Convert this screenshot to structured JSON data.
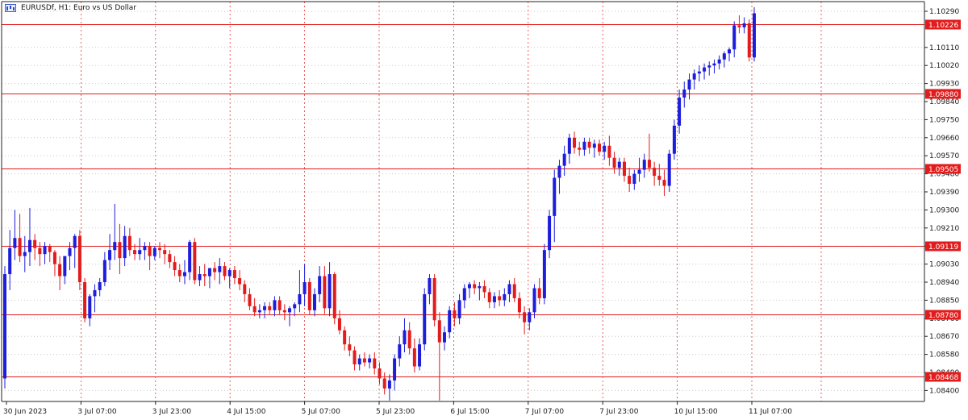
{
  "window": {
    "title": "EURUSDf, H1:  Euro vs US Dollar",
    "symbol_icon": "chart-window-icon"
  },
  "colors": {
    "bull": "#1d1ddc",
    "bear": "#e21c1c",
    "level": "#e21c1c",
    "grid": "#c8c8c8",
    "vgrid_dash": "#e03a3a",
    "background": "#ffffff"
  },
  "chart_data": {
    "type": "candlestick",
    "title": "EURUSDf, H1:  Euro vs US Dollar",
    "y_range": [
      1.0832,
      1.103
    ],
    "y_ticks": [
      "1.10290",
      "1.10110",
      "1.10020",
      "1.09930",
      "1.09840",
      "1.09750",
      "1.09660",
      "1.09570",
      "1.09480",
      "1.09390",
      "1.09300",
      "1.09210",
      "1.09120",
      "1.09030",
      "1.08940",
      "1.08850",
      "1.08760",
      "1.08670",
      "1.08580",
      "1.08490",
      "1.08400"
    ],
    "x_ticks": [
      "30 Jun 2023",
      "3 Jul 07:00",
      "3 Jul 23:00",
      "4 Jul 15:00",
      "5 Jul 07:00",
      "5 Jul 23:00",
      "6 Jul 15:00",
      "7 Jul 07:00",
      "7 Jul 23:00",
      "10 Jul 15:00",
      "11 Jul 07:00"
    ],
    "levels": [
      {
        "price": 1.10226,
        "label": "1.10226"
      },
      {
        "price": 1.0988,
        "label": "1.09880"
      },
      {
        "price": 1.09505,
        "label": "1.09505"
      },
      {
        "price": 1.09119,
        "label": "1.09119"
      },
      {
        "price": 1.0878,
        "label": "1.08780"
      },
      {
        "price": 1.08468,
        "label": "1.08468"
      }
    ],
    "candles": [
      [
        1.0846,
        1.0902,
        1.0841,
        1.0898
      ],
      [
        1.0898,
        1.092,
        1.089,
        1.0911
      ],
      [
        1.0911,
        1.093,
        1.0905,
        1.0916
      ],
      [
        1.0916,
        1.0928,
        1.0904,
        1.0907
      ],
      [
        1.0907,
        1.0917,
        1.0899,
        1.0909
      ],
      [
        1.0909,
        1.0931,
        1.0902,
        1.0915
      ],
      [
        1.0915,
        1.0918,
        1.0905,
        1.0911
      ],
      [
        1.0911,
        1.0914,
        1.0902,
        1.0908
      ],
      [
        1.0908,
        1.0914,
        1.0903,
        1.0912
      ],
      [
        1.0912,
        1.0913,
        1.0904,
        1.0909
      ],
      [
        1.0909,
        1.091,
        1.0897,
        1.0903
      ],
      [
        1.0903,
        1.0907,
        1.089,
        1.0897
      ],
      [
        1.0897,
        1.0906,
        1.0893,
        1.0907
      ],
      [
        1.0907,
        1.0914,
        1.09,
        1.0911
      ],
      [
        1.0911,
        1.0918,
        1.0901,
        1.0917
      ],
      [
        1.0917,
        1.092,
        1.089,
        1.0894
      ],
      [
        1.0894,
        1.0896,
        1.0874,
        1.0876
      ],
      [
        1.0876,
        1.0888,
        1.0872,
        1.0887
      ],
      [
        1.0887,
        1.0893,
        1.0879,
        1.089
      ],
      [
        1.089,
        1.0896,
        1.0887,
        1.0894
      ],
      [
        1.0894,
        1.0909,
        1.0892,
        1.0905
      ],
      [
        1.0905,
        1.0918,
        1.09,
        1.091
      ],
      [
        1.091,
        1.0933,
        1.0905,
        1.0914
      ],
      [
        1.0914,
        1.0923,
        1.0898,
        1.0906
      ],
      [
        1.0906,
        1.0922,
        1.0902,
        1.0917
      ],
      [
        1.0917,
        1.0921,
        1.0907,
        1.091
      ],
      [
        1.091,
        1.0913,
        1.0905,
        1.0908
      ],
      [
        1.0908,
        1.0916,
        1.0905,
        1.091
      ],
      [
        1.091,
        1.0914,
        1.0905,
        1.0912
      ],
      [
        1.0912,
        1.0914,
        1.09,
        1.0907
      ],
      [
        1.0907,
        1.0912,
        1.0905,
        1.0911
      ],
      [
        1.0911,
        1.0914,
        1.0906,
        1.091
      ],
      [
        1.091,
        1.0913,
        1.0903,
        1.0908
      ],
      [
        1.0908,
        1.091,
        1.0901,
        1.0904
      ],
      [
        1.0904,
        1.0907,
        1.0897,
        1.09
      ],
      [
        1.09,
        1.0903,
        1.0894,
        1.0897
      ],
      [
        1.0897,
        1.0905,
        1.0893,
        1.0899
      ],
      [
        1.0899,
        1.0915,
        1.0895,
        1.0914
      ],
      [
        1.0914,
        1.0916,
        1.0893,
        1.0895
      ],
      [
        1.0895,
        1.0902,
        1.0892,
        1.0898
      ],
      [
        1.0898,
        1.0903,
        1.0892,
        1.0897
      ],
      [
        1.0897,
        1.0901,
        1.0891,
        1.0901
      ],
      [
        1.0901,
        1.0904,
        1.0895,
        1.0899
      ],
      [
        1.0899,
        1.0906,
        1.0893,
        1.0902
      ],
      [
        1.0902,
        1.0904,
        1.0895,
        1.0897
      ],
      [
        1.0897,
        1.0901,
        1.0891,
        1.09
      ],
      [
        1.09,
        1.0902,
        1.0893,
        1.0896
      ],
      [
        1.0896,
        1.09,
        1.089,
        1.0893
      ],
      [
        1.0893,
        1.0895,
        1.0884,
        1.0888
      ],
      [
        1.0888,
        1.0891,
        1.088,
        1.0882
      ],
      [
        1.0882,
        1.0886,
        1.0877,
        1.0879
      ],
      [
        1.0879,
        1.0883,
        1.0876,
        1.088
      ],
      [
        1.088,
        1.0884,
        1.0876,
        1.0882
      ],
      [
        1.0882,
        1.0884,
        1.0878,
        1.088
      ],
      [
        1.088,
        1.0887,
        1.0877,
        1.0885
      ],
      [
        1.0885,
        1.0887,
        1.0878,
        1.088
      ],
      [
        1.088,
        1.0883,
        1.0875,
        1.0879
      ],
      [
        1.0879,
        1.0882,
        1.0872,
        1.0881
      ],
      [
        1.0881,
        1.0884,
        1.0877,
        1.0883
      ],
      [
        1.0883,
        1.09,
        1.0879,
        1.0888
      ],
      [
        1.0888,
        1.0903,
        1.0882,
        1.0894
      ],
      [
        1.0894,
        1.0896,
        1.0878,
        1.088
      ],
      [
        1.088,
        1.0891,
        1.0877,
        1.0888
      ],
      [
        1.0888,
        1.0902,
        1.0884,
        1.0897
      ],
      [
        1.0897,
        1.0902,
        1.0878,
        1.0881
      ],
      [
        1.0881,
        1.0904,
        1.0877,
        1.0898
      ],
      [
        1.0898,
        1.0899,
        1.0873,
        1.0876
      ],
      [
        1.0876,
        1.088,
        1.0868,
        1.087
      ],
      [
        1.087,
        1.0872,
        1.086,
        1.0863
      ],
      [
        1.0863,
        1.0867,
        1.0857,
        1.086
      ],
      [
        1.086,
        1.0862,
        1.085,
        1.0853
      ],
      [
        1.0853,
        1.0858,
        1.085,
        1.0856
      ],
      [
        1.0856,
        1.0859,
        1.0852,
        1.0854
      ],
      [
        1.0854,
        1.0858,
        1.0851,
        1.0856
      ],
      [
        1.0856,
        1.0859,
        1.0848,
        1.0851
      ],
      [
        1.0851,
        1.0854,
        1.0843,
        1.0846
      ],
      [
        1.0846,
        1.0849,
        1.0838,
        1.0841
      ],
      [
        1.0841,
        1.0848,
        1.0835,
        1.0845
      ],
      [
        1.0845,
        1.0858,
        1.084,
        1.0856
      ],
      [
        1.0856,
        1.0867,
        1.0852,
        1.0863
      ],
      [
        1.0863,
        1.0876,
        1.0859,
        1.087
      ],
      [
        1.087,
        1.0874,
        1.0858,
        1.0861
      ],
      [
        1.0861,
        1.0866,
        1.0849,
        1.0852
      ],
      [
        1.0852,
        1.0866,
        1.085,
        1.0863
      ],
      [
        1.0863,
        1.0891,
        1.086,
        1.0888
      ],
      [
        1.0888,
        1.0898,
        1.0883,
        1.0896
      ],
      [
        1.0896,
        1.0898,
        1.0872,
        1.0875
      ],
      [
        1.0875,
        1.0879,
        1.0835,
        1.0864
      ],
      [
        1.0864,
        1.0872,
        1.086,
        1.0869
      ],
      [
        1.0869,
        1.0882,
        1.0866,
        1.088
      ],
      [
        1.088,
        1.0884,
        1.0872,
        1.0876
      ],
      [
        1.0876,
        1.0888,
        1.0873,
        1.0885
      ],
      [
        1.0885,
        1.0893,
        1.0881,
        1.0891
      ],
      [
        1.0891,
        1.0894,
        1.0886,
        1.0893
      ],
      [
        1.0893,
        1.0895,
        1.0888,
        1.0891
      ],
      [
        1.0891,
        1.0894,
        1.0885,
        1.0892
      ],
      [
        1.0892,
        1.0895,
        1.0886,
        1.0889
      ],
      [
        1.0889,
        1.0891,
        1.0881,
        1.0884
      ],
      [
        1.0884,
        1.0889,
        1.0881,
        1.0887
      ],
      [
        1.0887,
        1.089,
        1.0882,
        1.0885
      ],
      [
        1.0885,
        1.0891,
        1.0882,
        1.0888
      ],
      [
        1.0888,
        1.0895,
        1.0884,
        1.0893
      ],
      [
        1.0893,
        1.0896,
        1.0884,
        1.0886
      ],
      [
        1.0886,
        1.0889,
        1.0876,
        1.0879
      ],
      [
        1.0879,
        1.0882,
        1.0868,
        1.0874
      ],
      [
        1.0874,
        1.0881,
        1.087,
        1.0879
      ],
      [
        1.0879,
        1.0893,
        1.0876,
        1.0891
      ],
      [
        1.0891,
        1.0896,
        1.0883,
        1.0886
      ],
      [
        1.0886,
        1.0913,
        1.0883,
        1.091
      ],
      [
        1.091,
        1.093,
        1.0906,
        1.0927
      ],
      [
        1.0927,
        1.095,
        1.0914,
        1.0946
      ],
      [
        1.0946,
        1.0955,
        1.0938,
        1.0952
      ],
      [
        1.0952,
        1.0962,
        1.0947,
        1.0958
      ],
      [
        1.0958,
        1.0968,
        1.0953,
        1.0966
      ],
      [
        1.0966,
        1.0969,
        1.0958,
        1.0961
      ],
      [
        1.0961,
        1.0964,
        1.0957,
        1.096
      ],
      [
        1.096,
        1.0966,
        1.0957,
        1.0964
      ],
      [
        1.0964,
        1.0966,
        1.0958,
        1.0961
      ],
      [
        1.0961,
        1.0965,
        1.0956,
        1.0963
      ],
      [
        1.0963,
        1.0965,
        1.0957,
        1.0959
      ],
      [
        1.0959,
        1.0964,
        1.0955,
        1.0962
      ],
      [
        1.0962,
        1.0967,
        1.0952,
        1.0956
      ],
      [
        1.0956,
        1.0959,
        1.0948,
        1.0951
      ],
      [
        1.0951,
        1.0956,
        1.0947,
        1.0954
      ],
      [
        1.0954,
        1.0956,
        1.0944,
        1.0947
      ],
      [
        1.0947,
        1.0951,
        1.0939,
        1.0943
      ],
      [
        1.0943,
        1.095,
        1.094,
        1.0948
      ],
      [
        1.0948,
        1.0956,
        1.0944,
        1.095
      ],
      [
        1.095,
        1.0958,
        1.0946,
        1.0955
      ],
      [
        1.0955,
        1.0968,
        1.0949,
        1.0951
      ],
      [
        1.0951,
        1.0954,
        1.0942,
        1.0947
      ],
      [
        1.0947,
        1.0953,
        1.0942,
        1.0945
      ],
      [
        1.0945,
        1.095,
        1.0937,
        1.0942
      ],
      [
        1.0942,
        1.096,
        1.0939,
        1.0958
      ],
      [
        1.0958,
        1.0975,
        1.0955,
        1.0972
      ],
      [
        1.0972,
        1.099,
        1.0968,
        1.0986
      ],
      [
        1.0986,
        1.0994,
        1.0981,
        1.099
      ],
      [
        1.099,
        1.0998,
        1.0985,
        1.0995
      ],
      [
        1.0995,
        1.1,
        1.099,
        1.0998
      ],
      [
        1.0998,
        1.1002,
        1.0994,
        1.0999
      ],
      [
        1.0999,
        1.1003,
        1.0995,
        1.1001
      ],
      [
        1.1001,
        1.1004,
        1.0997,
        1.1002
      ],
      [
        1.1002,
        1.1005,
        1.0998,
        1.1003
      ],
      [
        1.1003,
        1.1007,
        1.1,
        1.1005
      ],
      [
        1.1005,
        1.1009,
        1.1001,
        1.1008
      ],
      [
        1.1008,
        1.1011,
        1.1004,
        1.101
      ],
      [
        1.101,
        1.1024,
        1.1006,
        1.1022
      ],
      [
        1.1022,
        1.1027,
        1.1018,
        1.1021
      ],
      [
        1.1021,
        1.1026,
        1.1018,
        1.1023
      ],
      [
        1.1023,
        1.1025,
        1.1004,
        1.1006
      ],
      [
        1.1006,
        1.1031,
        1.1004,
        1.1028
      ]
    ]
  }
}
